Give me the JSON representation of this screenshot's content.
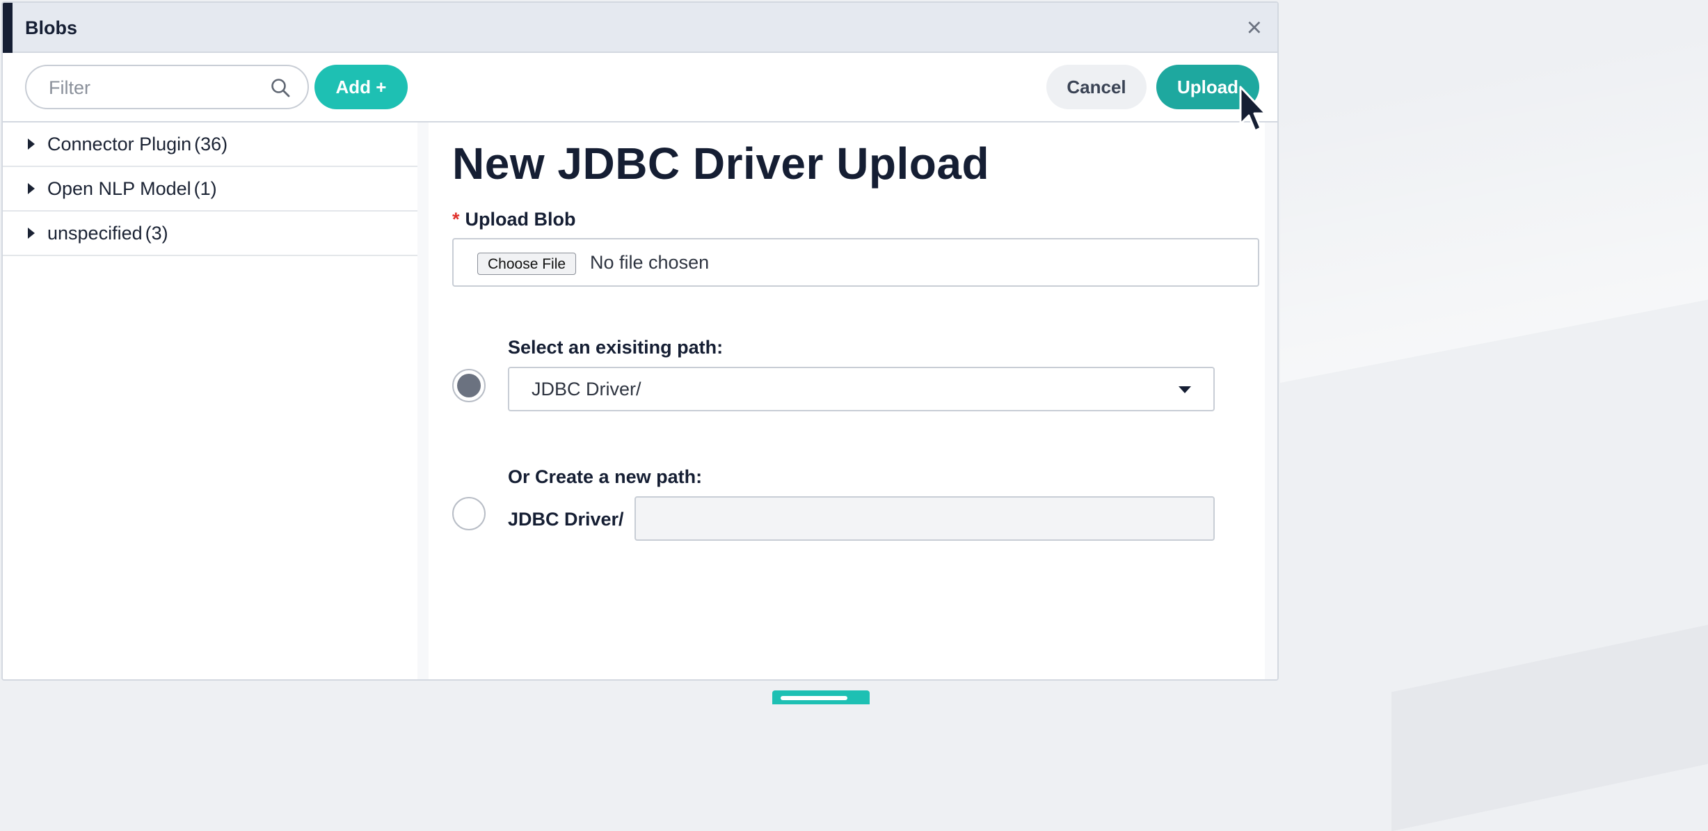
{
  "dialog": {
    "title": "Blobs",
    "close_glyph": "×"
  },
  "toolbar": {
    "filter_placeholder": "Filter",
    "add_label": "Add +",
    "cancel_label": "Cancel",
    "upload_label": "Upload"
  },
  "sidebar": {
    "items": [
      {
        "label": "Connector Plugin",
        "count": "(36)"
      },
      {
        "label": "Open NLP Model",
        "count": "(1)"
      },
      {
        "label": "unspecified",
        "count": "(3)"
      }
    ]
  },
  "form": {
    "title": "New JDBC Driver Upload",
    "upload_blob_label": "Upload Blob",
    "required_mark": "*",
    "choose_file_label": "Choose File",
    "file_status": "No file chosen",
    "existing_path_label": "Select an exisiting path:",
    "existing_path_value": "JDBC Driver/",
    "new_path_label": "Or Create a new path:",
    "new_path_prefix": "JDBC Driver/",
    "new_path_value": ""
  },
  "icons": {
    "search": "search-icon",
    "close": "close-icon",
    "caret": "caret-right-icon",
    "dropdown": "chevron-down-icon",
    "cursor": "mouse-pointer-icon"
  },
  "colors": {
    "accent_teal": "#1ec0b3",
    "upload_teal": "#1ea89f",
    "title_dark": "#151e33",
    "required_red": "#e0312b"
  }
}
